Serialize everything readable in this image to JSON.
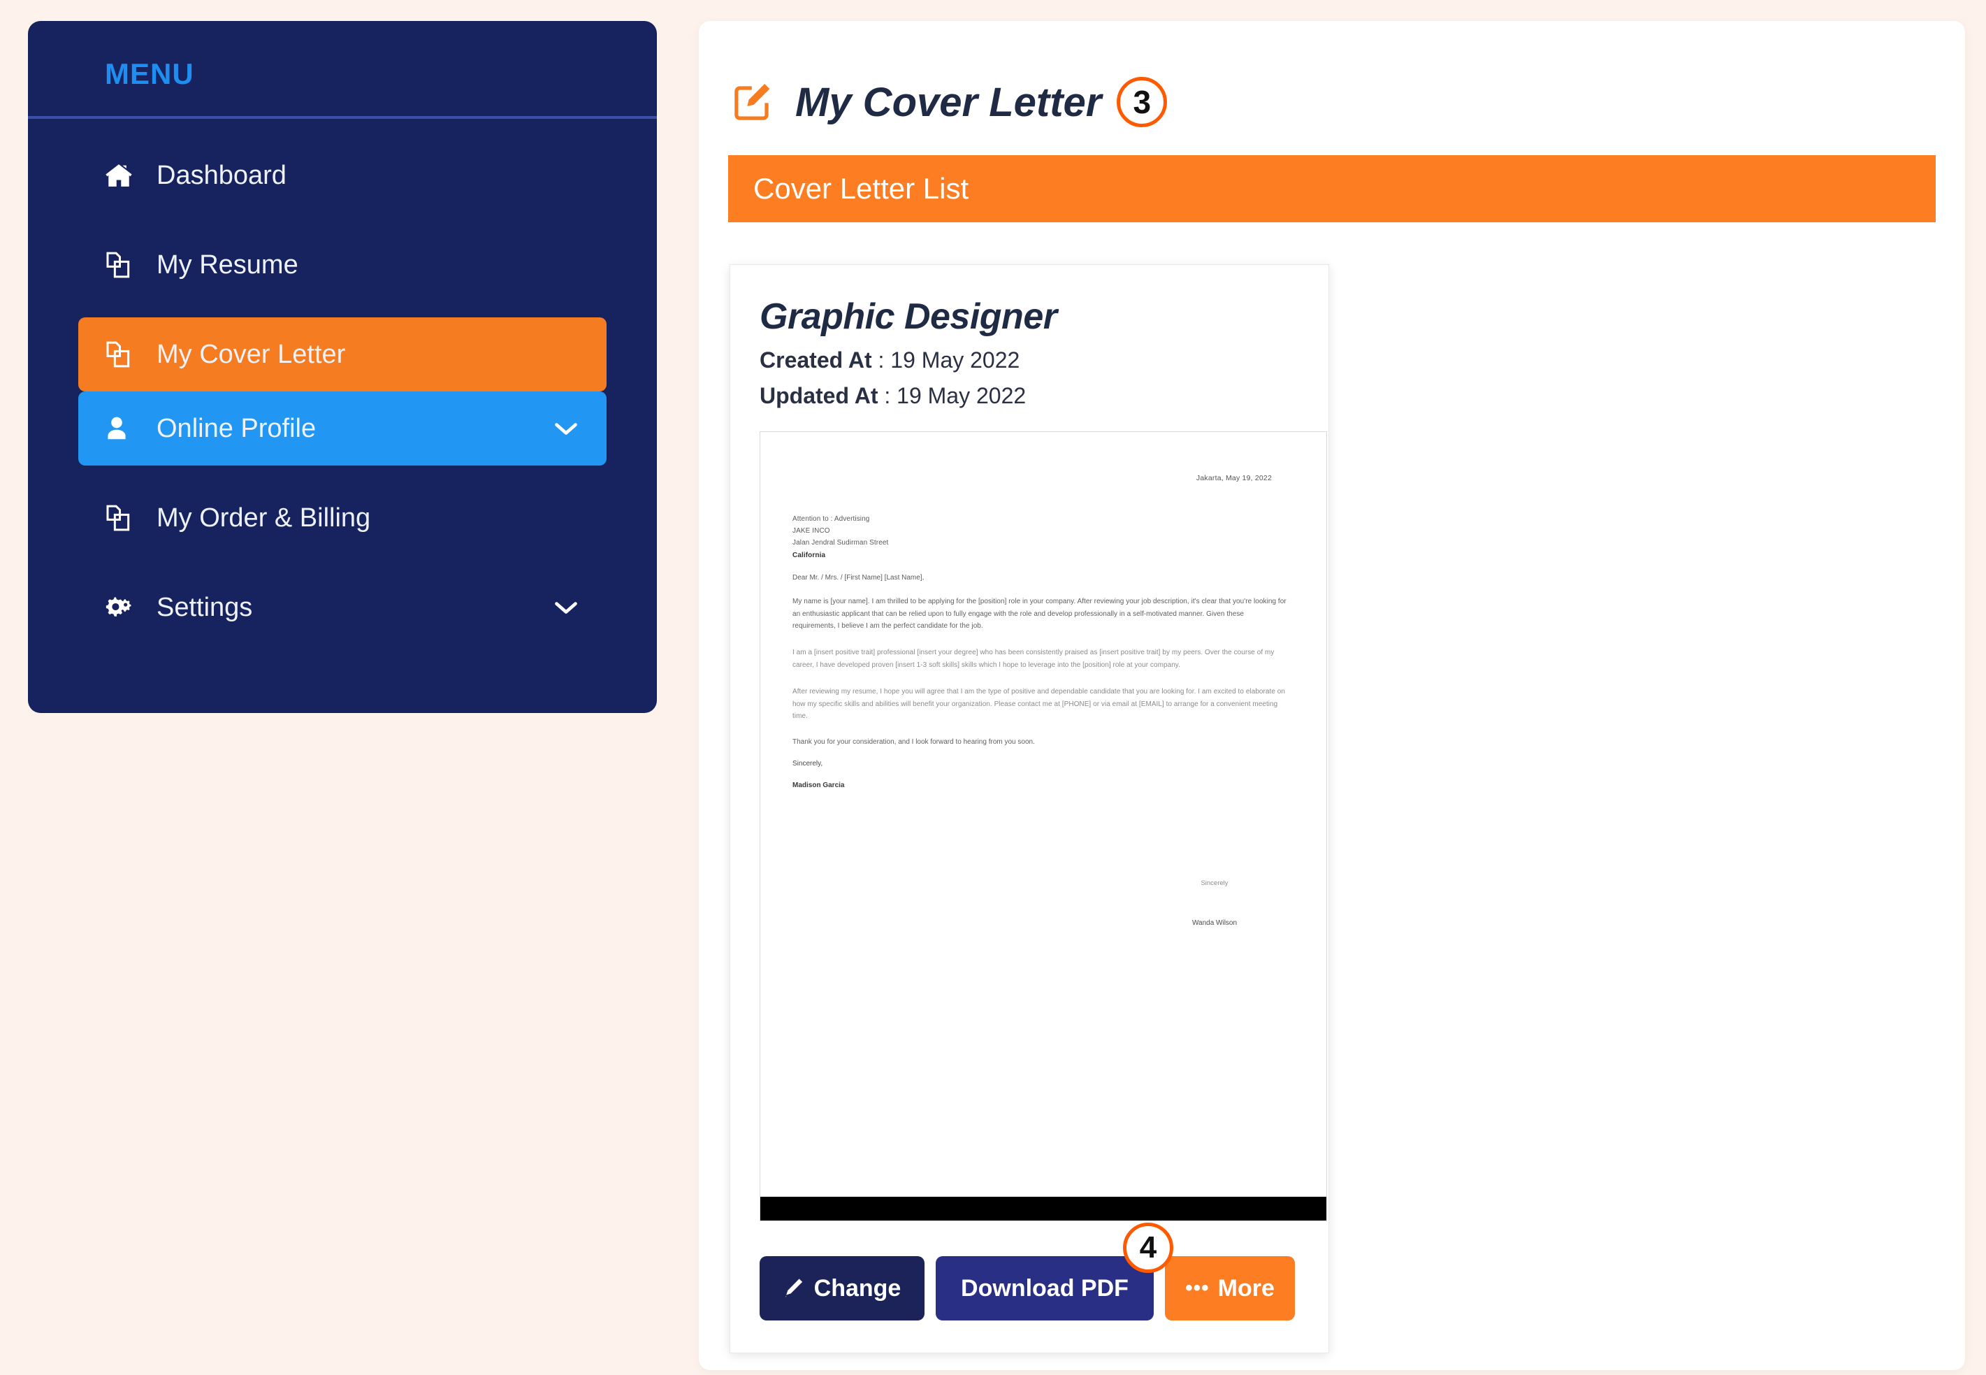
{
  "colors": {
    "page_background": "#fdf3ec",
    "sidebar_background": "#17235e",
    "accent_orange": "#fd7e22",
    "accent_blue": "#2196f3",
    "menu_title_blue": "#1f8ef1",
    "badge_orange": "#ff5a00",
    "navy_dark": "#1b2359",
    "navy_mid": "#2a2f86"
  },
  "sidebar": {
    "title": "MENU",
    "items": [
      {
        "label": "Dashboard",
        "icon": "home-icon",
        "state": "default",
        "chevron": false
      },
      {
        "label": "My Resume",
        "icon": "copy-files-icon",
        "state": "default",
        "chevron": false
      },
      {
        "label": "My Cover Letter",
        "icon": "copy-files-icon",
        "state": "active-orange",
        "chevron": false
      },
      {
        "label": "Online Profile",
        "icon": "user-icon",
        "state": "active-blue",
        "chevron": true
      },
      {
        "label": "My Order & Billing",
        "icon": "copy-files-icon",
        "state": "default",
        "chevron": false
      },
      {
        "label": "Settings",
        "icon": "cogs-icon",
        "state": "default",
        "chevron": true
      }
    ]
  },
  "main": {
    "page_title": "My Cover Letter",
    "page_title_icon": "edit-square-icon",
    "step_badge_title": "3",
    "list_bar_label": "Cover Letter List"
  },
  "card": {
    "title": "Graphic Designer",
    "created_label": "Created At",
    "created_value": ": 19 May 2022",
    "updated_label": "Updated At",
    "updated_value": ": 19 May 2022",
    "step_badge_actions": "4",
    "buttons": {
      "change": "Change",
      "change_icon": "pencil-icon",
      "download": "Download PDF",
      "more": "More",
      "more_icon": "ellipsis-icon"
    }
  },
  "preview": {
    "date": "Jakarta, May 19, 2022",
    "recipient_lines": [
      "Attention to : Advertising",
      "JAKE INCO",
      "Jalan Jendral Sudirman Street",
      "California"
    ],
    "recipient_bold_index": 3,
    "salutation": "Dear Mr. / Mrs. / [First Name] [Last Name],",
    "paragraphs": [
      "My name is [your name]. I am thrilled to be applying for the [position] role in your company. After reviewing your job description, it's clear that you're looking for an enthusiastic applicant that can be relied upon to fully engage with the role and develop professionally in a self-motivated manner. Given these requirements, I believe I am the perfect candidate for the job.",
      "I am a [insert positive trait] professional [insert your degree] who has been consistently praised as [insert positive trait] by my peers. Over the course of my career, I have developed proven [insert 1-3 soft skills] skills which I hope to leverage into the [position] role at your company.",
      "After reviewing my resume, I hope you will agree that I am the type of positive and dependable candidate that you are looking for. I am excited to elaborate on how my specific skills and abilities will benefit your organization. Please contact me at [PHONE] or via email at [EMAIL] to arrange for a convenient meeting time."
    ],
    "closing": "Thank you for your consideration, and I look forward to hearing from you soon.",
    "signoff": "Sincerely,",
    "author_name": "Madison Garcia",
    "signature_label": "Sincerely",
    "signature_name": "Wanda Wilson"
  }
}
